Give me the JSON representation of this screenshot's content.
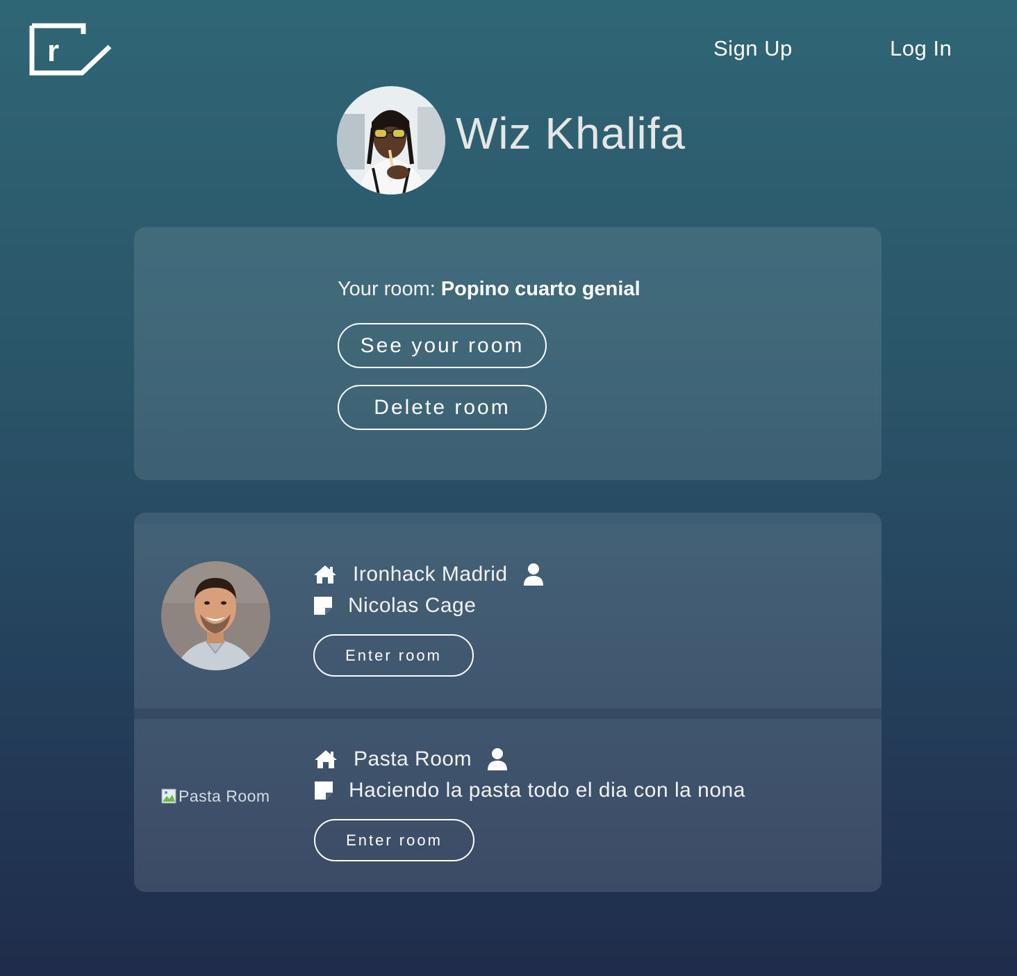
{
  "nav": {
    "signup_label": "Sign Up",
    "login_label": "Log In",
    "logo_icon": "r-logo-icon"
  },
  "profile": {
    "name": "Wiz Khalifa",
    "avatar_icon": "profile-avatar"
  },
  "my_room": {
    "prefix": "Your room:",
    "room_name": "Popino cuarto genial",
    "see_label": "See your room",
    "delete_label": "Delete room"
  },
  "rooms": [
    {
      "name": "Ironhack Madrid",
      "owner": "Nicolas Cage",
      "enter_label": "Enter room",
      "image": "avatar-photo"
    },
    {
      "name": "Pasta Room",
      "description": "Haciendo la pasta todo el dia con la nona",
      "enter_label": "Enter room",
      "image_alt": "Pasta Room"
    }
  ],
  "colors": {
    "bg_top": "#2f6675",
    "bg_bottom": "#1f2c4b",
    "text": "#ffffff"
  }
}
